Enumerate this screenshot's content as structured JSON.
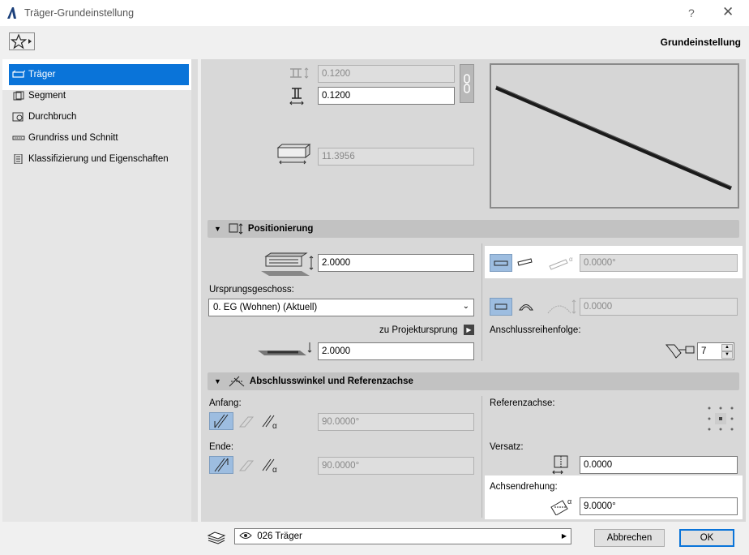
{
  "window": {
    "title": "Träger-Grundeinstellung",
    "help_label": "?",
    "close_label": "✕"
  },
  "header": {
    "right_label": "Grundeinstellung"
  },
  "sidebar": {
    "items": [
      {
        "label": "Träger",
        "icon": "beam-icon"
      },
      {
        "label": "Segment",
        "icon": "segment-icon"
      },
      {
        "label": "Durchbruch",
        "icon": "opening-icon"
      },
      {
        "label": "Grundriss und Schnitt",
        "icon": "floorplan-icon"
      },
      {
        "label": "Klassifizierung und Eigenschaften",
        "icon": "properties-icon"
      }
    ]
  },
  "geometry": {
    "width_top": "0.1200",
    "width_bottom": "0.1200",
    "length": "11.3956"
  },
  "positioning": {
    "section_label": "Positionierung",
    "height_value": "2.0000",
    "origin_story_label": "Ursprungsgeschoss:",
    "origin_story_value": "0. EG (Wohnen) (Aktuell)",
    "project_origin_label": "zu Projektursprung",
    "offset_value": "2.0000",
    "tilt_angle": "0.0000°",
    "curve_value": "0.0000",
    "connection_order_label": "Anschlussreihenfolge:",
    "connection_order_value": "7"
  },
  "end_angles": {
    "section_label": "Abschlusswinkel und Referenzachse",
    "start_label": "Anfang:",
    "start_angle": "90.0000°",
    "end_label": "Ende:",
    "end_angle": "90.0000°",
    "reference_axis_label": "Referenzachse:",
    "offset_label": "Versatz:",
    "offset_value": "0.0000",
    "axis_rotation_label": "Achsendrehung:",
    "axis_rotation_value": "9.0000°"
  },
  "footer": {
    "layer_value": "026 Träger",
    "cancel_label": "Abbrechen",
    "ok_label": "OK"
  },
  "colors": {
    "accent": "#0a74d9",
    "toggle_on": "#9dbde0"
  }
}
